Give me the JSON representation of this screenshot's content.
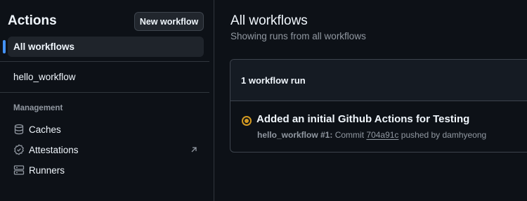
{
  "sidebar": {
    "title": "Actions",
    "new_workflow_label": "New workflow",
    "all_workflows_label": "All workflows",
    "workflows": [
      {
        "label": "hello_workflow"
      }
    ],
    "management_heading": "Management",
    "management_items": [
      {
        "label": "Caches",
        "icon": "database-icon"
      },
      {
        "label": "Attestations",
        "icon": "verified-icon",
        "external": true
      },
      {
        "label": "Runners",
        "icon": "server-icon"
      }
    ]
  },
  "main": {
    "title": "All workflows",
    "subtitle": "Showing runs from all workflows",
    "runs_count_label": "1 workflow run",
    "runs": [
      {
        "status": "in-progress",
        "status_color": "#d29922",
        "title": "Added an initial Github Actions for Testing",
        "workflow": "hello_workflow #1:",
        "commit_prefix": "Commit",
        "commit_sha": "704a91c",
        "pushed_by": "pushed by damhyeong"
      }
    ]
  },
  "colors": {
    "background": "#0d1117",
    "accent": "#4493f8",
    "border": "#30363d",
    "muted_text": "#9198a1"
  }
}
